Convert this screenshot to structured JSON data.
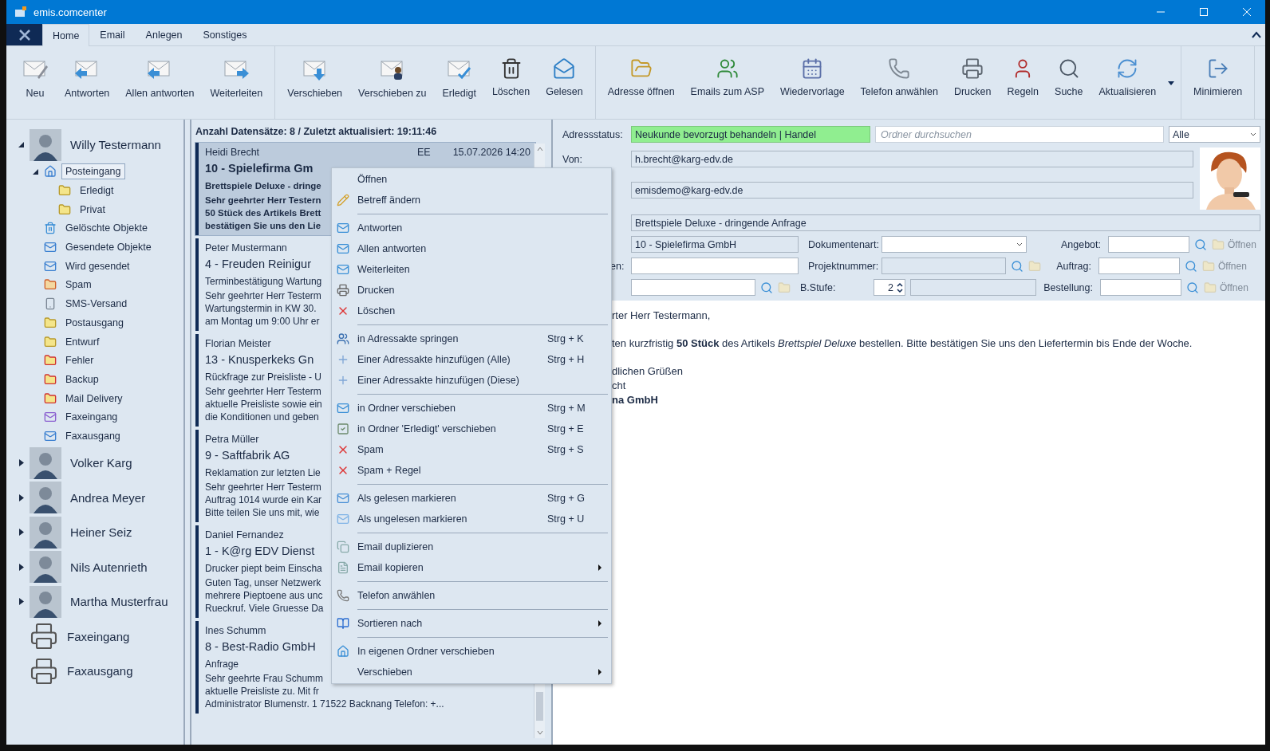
{
  "window": {
    "title": "emis.comcenter"
  },
  "ribbon": {
    "tabs": [
      {
        "label": "Home",
        "selected": true
      },
      {
        "label": "Email",
        "selected": false
      },
      {
        "label": "Anlegen",
        "selected": false
      },
      {
        "label": "Sonstiges",
        "selected": false
      }
    ],
    "groups": [
      [
        {
          "label": "Neu"
        },
        {
          "label": "Antworten"
        },
        {
          "label": "Allen antworten"
        },
        {
          "label": "Weiterleiten"
        }
      ],
      [
        {
          "label": "Verschieben"
        },
        {
          "label": "Verschieben zu"
        },
        {
          "label": "Erledigt"
        },
        {
          "label": "Löschen"
        },
        {
          "label": "Gelesen"
        }
      ],
      [
        {
          "label": "Adresse öffnen"
        },
        {
          "label": "Emails zum ASP"
        },
        {
          "label": "Wiedervorlage"
        },
        {
          "label": "Telefon anwählen"
        },
        {
          "label": "Drucken"
        },
        {
          "label": "Regeln"
        },
        {
          "label": "Suche"
        },
        {
          "label": "Aktualisieren"
        }
      ],
      [
        {
          "label": "Minimieren"
        }
      ]
    ]
  },
  "tree": [
    {
      "label": "Willy Testermann",
      "kind": "person",
      "expanded": true,
      "children": [
        {
          "label": "Posteingang",
          "kind": "inbox",
          "selected": true,
          "expanded": true,
          "children": [
            {
              "label": "Erledigt",
              "kind": "folder",
              "selected": false
            },
            {
              "label": "Privat",
              "kind": "folder",
              "selected": false
            }
          ]
        },
        {
          "label": "Gelöschte Objekte",
          "kind": "trash",
          "selected": false
        },
        {
          "label": "Gesendete Objekte",
          "kind": "outbox",
          "selected": false
        },
        {
          "label": "Wird gesendet",
          "kind": "outbox",
          "selected": false
        },
        {
          "label": "Spam",
          "kind": "spam",
          "selected": false
        },
        {
          "label": "SMS-Versand",
          "kind": "sms",
          "selected": false
        },
        {
          "label": "Postausgang",
          "kind": "folder",
          "selected": false
        },
        {
          "label": "Entwurf",
          "kind": "folder",
          "selected": false
        },
        {
          "label": "Fehler",
          "kind": "error",
          "selected": false
        },
        {
          "label": "Backup",
          "kind": "error",
          "selected": false
        },
        {
          "label": "Mail Delivery",
          "kind": "error",
          "selected": false
        },
        {
          "label": "Faxeingang",
          "kind": "faxin",
          "selected": false
        },
        {
          "label": "Faxausgang",
          "kind": "outbox",
          "selected": false
        }
      ]
    },
    {
      "label": "Volker Karg",
      "kind": "person",
      "expanded": false
    },
    {
      "label": "Andrea Meyer",
      "kind": "person",
      "expanded": false
    },
    {
      "label": "Heiner Seiz",
      "kind": "person",
      "expanded": false
    },
    {
      "label": "Nils Autenrieth",
      "kind": "person",
      "expanded": false
    },
    {
      "label": "Martha Musterfrau",
      "kind": "person",
      "expanded": false
    },
    {
      "label": "Faxeingang",
      "kind": "fax"
    },
    {
      "label": "Faxausgang",
      "kind": "fax"
    }
  ],
  "list": {
    "header": "Anzahl Datensätze: 8 / Zuletzt aktualisiert: 19:11:46",
    "items": [
      {
        "sender": "Heidi Brecht",
        "code": "EE",
        "date": "15.07.2026 14:20",
        "title": "10 - Spielefirma Gm",
        "subject": "Brettspiele Deluxe - dringe",
        "lines": [
          "Sehr geehrter Herr Testern",
          "50 Stück des Artikels Brett",
          "bestätigen Sie uns den Lie"
        ],
        "selected": true
      },
      {
        "sender": "Peter Mustermann",
        "title": "4 - Freuden Reinigur",
        "subject": "Terminbestätigung Wartung",
        "lines": [
          "Sehr geehrter Herr Testerm",
          "Wartungstermin in KW 30.",
          "am Montag um 9:00 Uhr er"
        ],
        "selected": false
      },
      {
        "sender": "Florian Meister",
        "title": "13 - Knusperkeks Gn",
        "subject": "Rückfrage zur Preisliste - U",
        "lines": [
          "Sehr geehrter Herr Testerm",
          "aktuelle Preisliste sowie ein",
          "die Konditionen und geben"
        ],
        "selected": false
      },
      {
        "sender": "Petra Müller",
        "title": "9 - Saftfabrik AG",
        "subject": "Reklamation zur letzten Lie",
        "lines": [
          "Sehr geehrter Herr Testerm",
          "Auftrag 1014 wurde ein Kar",
          "Bitte teilen Sie uns mit, wie"
        ],
        "selected": false
      },
      {
        "sender": "Daniel Fernandez",
        "title": "1 - K@rg EDV Dienst",
        "subject": "Drucker piept beim Einscha",
        "lines": [
          "Guten Tag,  unser Netzwerk",
          "mehrere Pieptoene aus unc",
          "Rueckruf.  Viele Gruesse Da"
        ],
        "selected": false
      },
      {
        "sender": "Ines Schumm",
        "title": "8 - Best-Radio GmbH",
        "subject": "Anfrage",
        "lines": [
          "Sehr geehrte Frau Schumm",
          "aktuelle Preisliste zu.  Mit fr",
          "Administrator  Blumenstr. 1  71522 Backnang  Telefon: +..."
        ],
        "selected": false
      }
    ]
  },
  "detail": {
    "status_label": "Adressstatus:",
    "status": "Neukunde bevorzugt behandeln | Handel",
    "search": {
      "placeholder": "Ordner durchsuchen"
    },
    "filter": "Alle",
    "from_label": "Von:",
    "from": "h.brecht@karg-edv.de",
    "to": "emisdemo@karg-edv.de",
    "subject": "Brettspiele Deluxe - dringende Anfrage",
    "address": "10 - Spielefirma GmbH",
    "row2_label": "en:",
    "doc_label": "Dokumentenart:",
    "project_label": "Projektnummer:",
    "stage_label": "B.Stufe:",
    "stage": "2",
    "refs": [
      {
        "label": "Angebot:",
        "button": "Öffnen",
        "disabled": true
      },
      {
        "label": "Auftrag:",
        "button": "Öffnen",
        "disabled": true
      },
      {
        "label": "Bestellung:",
        "button": "Öffnen",
        "disabled": true
      }
    ],
    "body": [
      [
        "rter Herr Testermann,"
      ],
      [
        "ten kurzfristig **50 Stück** des Artikels *Brettspiel Deluxe* bestellen. Bitte bestätigen Sie uns den Liefertermin bis Ende der Woche."
      ],
      [
        "dlichen Grüßen",
        "cht",
        "**na GmbH**"
      ]
    ]
  },
  "menu": {
    "groups": [
      [
        {
          "label": "Öffnen"
        },
        {
          "label": "Betreff ändern"
        }
      ],
      [
        {
          "label": "Antworten"
        },
        {
          "label": "Allen antworten"
        },
        {
          "label": "Weiterleiten"
        },
        {
          "label": "Drucken"
        },
        {
          "label": "Löschen"
        }
      ],
      [
        {
          "label": "in Adressakte springen",
          "shortcut": "Strg + K"
        },
        {
          "label": "Einer Adressakte hinzufügen (Alle)",
          "shortcut": "Strg + H"
        },
        {
          "label": "Einer Adressakte hinzufügen (Diese)"
        }
      ],
      [
        {
          "label": "in Ordner verschieben",
          "shortcut": "Strg + M"
        },
        {
          "label": "in Ordner 'Erledigt' verschieben",
          "shortcut": "Strg + E"
        },
        {
          "label": "Spam",
          "shortcut": "Strg + S"
        },
        {
          "label": "Spam + Regel"
        }
      ],
      [
        {
          "label": "Als gelesen markieren",
          "shortcut": "Strg + G"
        },
        {
          "label": "Als ungelesen markieren",
          "shortcut": "Strg + U"
        }
      ],
      [
        {
          "label": "Email duplizieren",
          "submenu": false
        },
        {
          "label": "Email kopieren",
          "submenu": true
        }
      ],
      [
        {
          "label": "Telefon anwählen"
        }
      ],
      [
        {
          "label": "Sortieren nach",
          "submenu": true
        }
      ],
      [
        {
          "label": "In eigenen Ordner verschieben",
          "submenu": false
        },
        {
          "label": "Verschieben",
          "submenu": true
        }
      ]
    ]
  }
}
